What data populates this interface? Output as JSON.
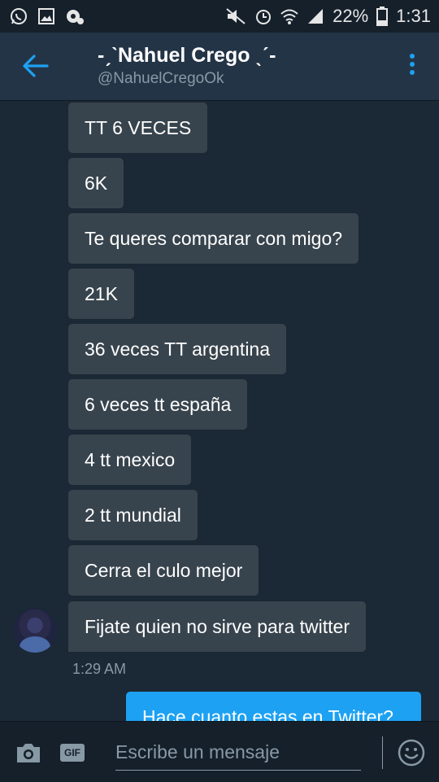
{
  "status_bar": {
    "icons_left": [
      "whatsapp-icon",
      "image-icon",
      "settings-notification-icon"
    ],
    "icons_right": [
      "mute-icon",
      "alarm-icon",
      "wifi-icon",
      "signal-icon"
    ],
    "battery": "22%",
    "time": "1:31"
  },
  "header": {
    "title": "-ˏˋNahuel Crego ˎˊ-",
    "handle": "@NahuelCregoOk",
    "accent_color": "#1da1f2"
  },
  "messages": {
    "received": [
      {
        "text": "TT 6 VECES"
      },
      {
        "text": "6K"
      },
      {
        "text": "Te queres comparar con migo?"
      },
      {
        "text": "21K"
      },
      {
        "text": "36 veces TT argentina"
      },
      {
        "text": "6 veces tt españa"
      },
      {
        "text": "4 tt mexico"
      },
      {
        "text": "2 tt mundial"
      },
      {
        "text": "Cerra el culo mejor"
      },
      {
        "text": "Fijate quien no sirve para twitter"
      }
    ],
    "timestamp": "1:29 AM",
    "sent": [
      {
        "text": "Hace cuanto estas en Twitter?"
      }
    ]
  },
  "composer": {
    "gif_label": "GIF",
    "placeholder": "Escribe un mensaje"
  },
  "colors": {
    "background": "#1b2835",
    "received_bubble": "#38444d",
    "sent_bubble": "#1da1f2",
    "secondary_text": "#8899a6"
  }
}
